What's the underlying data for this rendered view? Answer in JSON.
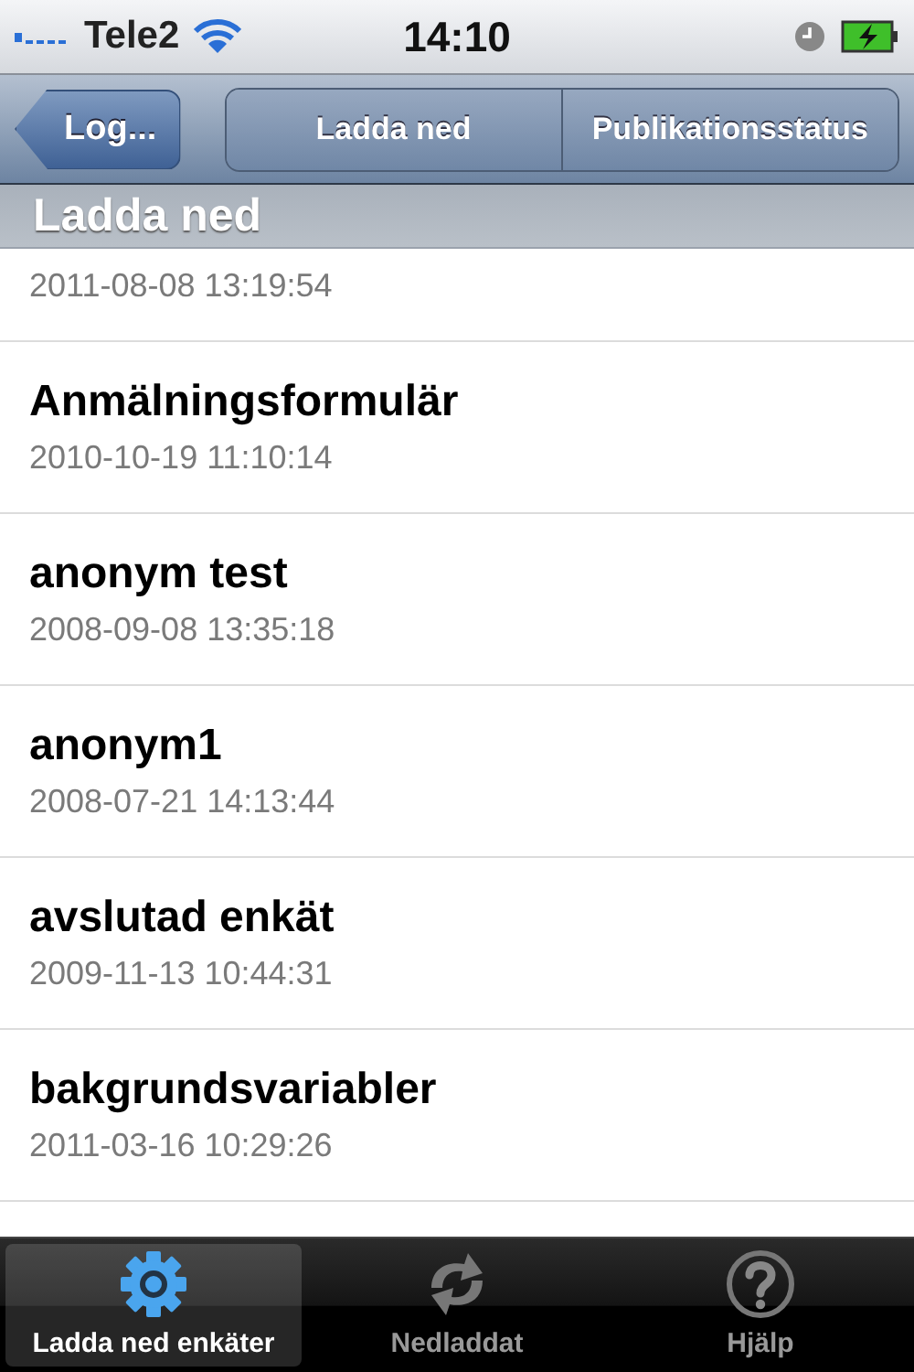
{
  "status_bar": {
    "carrier": "Tele2",
    "time": "14:10"
  },
  "nav_bar": {
    "back": "Log...",
    "segments": [
      {
        "label": "Ladda ned",
        "selected": false
      },
      {
        "label": "Publikationsstatus",
        "selected": false
      }
    ]
  },
  "section_header": "Ladda ned",
  "surveys": [
    {
      "date": "2011-08-08 13:19:54"
    },
    {
      "title": "Anmälningsformulär",
      "date": "2010-10-19 11:10:14"
    },
    {
      "title": "anonym test",
      "date": "2008-09-08 13:35:18"
    },
    {
      "title": "anonym1",
      "date": "2008-07-21 14:13:44"
    },
    {
      "title": "avslutad enkät",
      "date": "2009-11-13 10:44:31"
    },
    {
      "title": "bakgrundsvariabler",
      "date": "2011-03-16 10:29:26"
    }
  ],
  "tab_bar": [
    {
      "kind": "gear",
      "label": "Ladda ned enkäter",
      "selected": true
    },
    {
      "kind": "sync",
      "label": "Nedladdat",
      "selected": false
    },
    {
      "kind": "help",
      "label": "Hjälp",
      "selected": false
    }
  ]
}
